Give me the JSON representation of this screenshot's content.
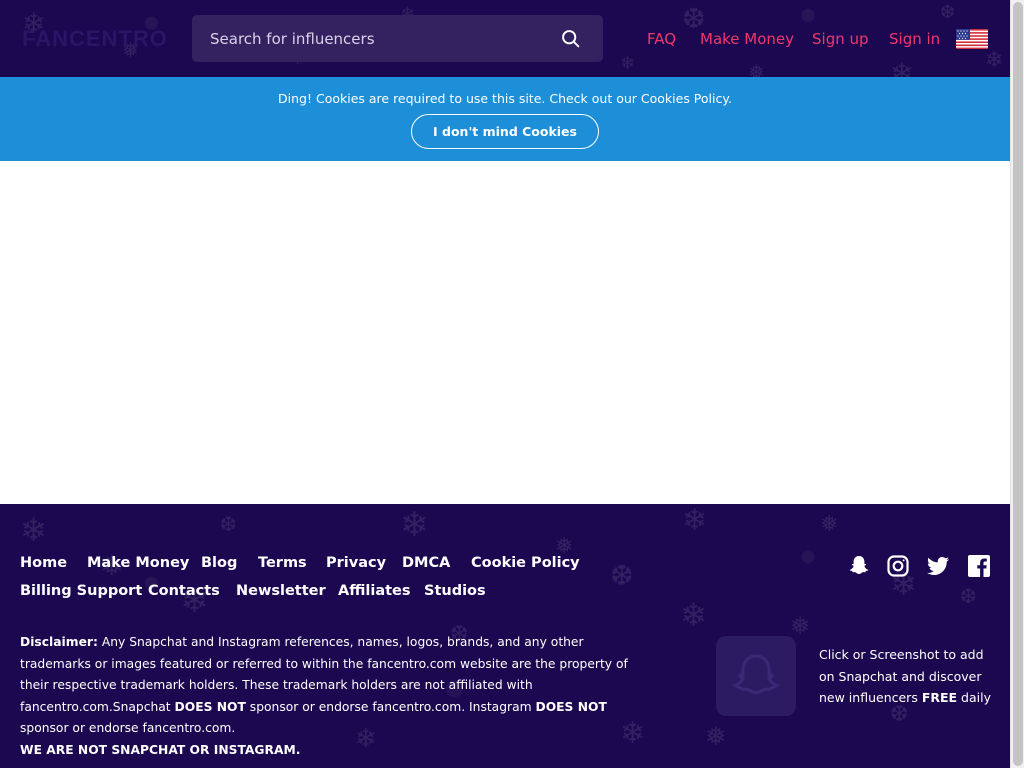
{
  "header": {
    "logo": "FANCENTRO",
    "search": {
      "placeholder": "Search for influencers"
    },
    "nav": {
      "faq": "FAQ",
      "make_money": "Make Money",
      "sign_up": "Sign up",
      "sign_in": "Sign in"
    }
  },
  "cookie_bar": {
    "message": "Ding! Cookies are required to use this site. Check out our Cookies Policy.",
    "button": "I don't mind Cookies"
  },
  "footer": {
    "links": {
      "home": "Home",
      "make_money": "Make Money",
      "blog": "Blog",
      "terms": "Terms",
      "privacy": "Privacy",
      "dmca": "DMCA",
      "cookie_policy": "Cookie Policy",
      "billing_support": "Billing Support",
      "contacts": "Contacts",
      "newsletter": "Newsletter",
      "affiliates": "Affiliates",
      "studios": "Studios"
    },
    "disclaimer": {
      "label": "Disclaimer:",
      "text1": " Any Snapchat and Instagram references, names, logos, brands, and any other trademarks or images featured or referred to within the fancentro.com website are the property of their respective trademark holders. These trademark holders are not affiliated with fancentro.com.Snapchat ",
      "emph1": "DOES NOT",
      "text2": " sponsor or endorse fancentro.com. Instagram ",
      "emph2": "DOES NOT",
      "text3": " sponsor or endorse fancentro.com.",
      "final": "WE ARE NOT SNAPCHAT OR INSTAGRAM."
    },
    "snap_promo": {
      "text": "Click or Screenshot to add on Snapchat and discover new influencers ",
      "emph": "FREE",
      "suffix": " daily"
    },
    "social_icons": [
      "snapchat-icon",
      "instagram-icon",
      "twitter-icon",
      "facebook-icon"
    ]
  },
  "colors": {
    "background_purple": "#1b0850",
    "accent_pink": "#f0386a",
    "cookie_blue": "#1d8fd8",
    "search_bg": "#33225f"
  }
}
